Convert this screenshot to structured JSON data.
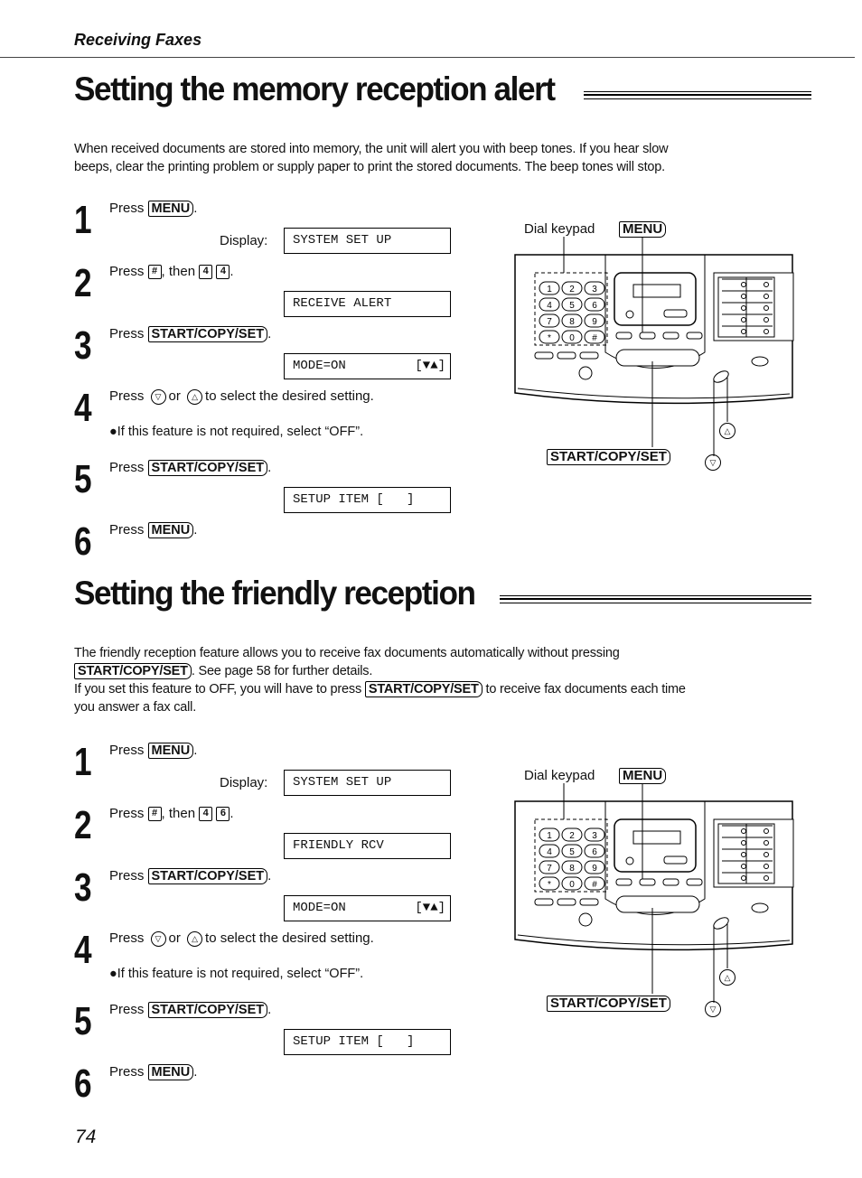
{
  "header": {
    "section": "Receiving Faxes"
  },
  "sections": [
    {
      "title": "Setting the memory reception alert",
      "intro": [
        "When received documents are stored into memory, the unit will alert you with beep tones. If you hear slow",
        "beeps, clear the printing problem or supply paper to print the stored documents. The beep tones will stop."
      ],
      "steps": [
        {
          "num": "1",
          "press": "Press",
          "key": "MENU",
          "end": ".",
          "display_label": "Display:",
          "display": "SYSTEM SET UP"
        },
        {
          "num": "2",
          "press": "Press",
          "hash": "#",
          "then": ", then",
          "keys": [
            "4",
            "4"
          ],
          "end": ".",
          "display": "RECEIVE ALERT"
        },
        {
          "num": "3",
          "press": "Press",
          "key": "START/COPY/SET",
          "end": ".",
          "display": "MODE=ON",
          "display_right": "[▼▲]"
        },
        {
          "num": "4",
          "press": "Press",
          "down": "▽",
          "or": "or",
          "up": "△",
          "rest": "to select the desired setting.",
          "note": "●If this feature is not required, select “OFF”."
        },
        {
          "num": "5",
          "press": "Press",
          "key": "START/COPY/SET",
          "end": ".",
          "display": "SETUP ITEM [   ]"
        },
        {
          "num": "6",
          "press": "Press",
          "key": "MENU",
          "end": "."
        }
      ],
      "diagram": {
        "dial_keypad": "Dial keypad",
        "menu": "MENU",
        "start": "START/COPY/SET",
        "up": "△",
        "down": "▽",
        "keypad_keys": [
          "1",
          "2",
          "3",
          "4",
          "5",
          "6",
          "7",
          "8",
          "9",
          "*",
          "0",
          "#"
        ]
      }
    },
    {
      "title": "Setting the friendly reception",
      "intro_parts": {
        "l1": "The friendly reception feature allows you to receive fax documents automatically without pressing",
        "key": "START/COPY/SET",
        "l2": ". See page 58 for further details.",
        "l3a": "If you set this feature to OFF, you will have to press",
        "l3b": "to receive fax documents each time",
        "l4": "you answer a fax call."
      },
      "steps": [
        {
          "num": "1",
          "press": "Press",
          "key": "MENU",
          "end": ".",
          "display_label": "Display:",
          "display": "SYSTEM SET UP"
        },
        {
          "num": "2",
          "press": "Press",
          "hash": "#",
          "then": ", then",
          "keys": [
            "4",
            "6"
          ],
          "end": ".",
          "display": "FRIENDLY RCV"
        },
        {
          "num": "3",
          "press": "Press",
          "key": "START/COPY/SET",
          "end": ".",
          "display": "MODE=ON",
          "display_right": "[▼▲]"
        },
        {
          "num": "4",
          "press": "Press",
          "down": "▽",
          "or": "or",
          "up": "△",
          "rest": "to select the desired setting.",
          "note": "●If this feature is not required, select “OFF”."
        },
        {
          "num": "5",
          "press": "Press",
          "key": "START/COPY/SET",
          "end": ".",
          "display": "SETUP ITEM [   ]"
        },
        {
          "num": "6",
          "press": "Press",
          "key": "MENU",
          "end": "."
        }
      ],
      "diagram": {
        "dial_keypad": "Dial keypad",
        "menu": "MENU",
        "start": "START/COPY/SET",
        "up": "△",
        "down": "▽",
        "keypad_keys": [
          "1",
          "2",
          "3",
          "4",
          "5",
          "6",
          "7",
          "8",
          "9",
          "*",
          "0",
          "#"
        ]
      }
    }
  ],
  "footer": {
    "page_number": "74"
  }
}
